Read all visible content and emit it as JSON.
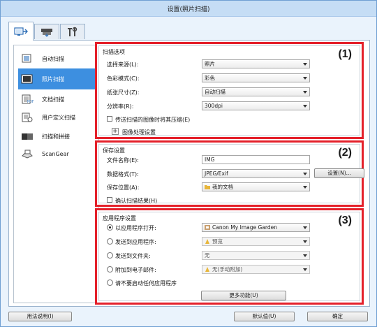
{
  "window": {
    "title": "设置(照片扫描)"
  },
  "tabs": [
    {
      "icon": "scan-from-computer-icon"
    },
    {
      "icon": "scanner-panel-icon"
    },
    {
      "icon": "general-settings-tools-icon"
    }
  ],
  "sidebar": {
    "items": [
      {
        "label": "自动扫描",
        "icon": "auto-scan-icon"
      },
      {
        "label": "照片扫描",
        "icon": "photo-scan-icon",
        "selected": true
      },
      {
        "label": "文档扫描",
        "icon": "document-scan-icon"
      },
      {
        "label": "用户定义扫描",
        "icon": "custom-scan-icon"
      },
      {
        "label": "扫描和拼接",
        "icon": "scan-stitch-icon"
      },
      {
        "label": "ScanGear",
        "icon": "scangear-icon"
      }
    ]
  },
  "scan_options": {
    "title": "扫描选项",
    "number": "(1)",
    "source": {
      "label": "选择来源(L):",
      "value": "照片"
    },
    "color_mode": {
      "label": "色彩模式(C):",
      "value": "彩色"
    },
    "paper_size": {
      "label": "纸张尺寸(Z):",
      "value": "自动扫描"
    },
    "resolution": {
      "label": "分辨率(R):",
      "value": "300dpi"
    },
    "compress_checkbox": {
      "label": "传送扫描的图像时将其压缩(E)",
      "checked": false
    },
    "image_processing": {
      "label": "图像处理设置"
    }
  },
  "save_settings": {
    "title": "保存设置",
    "number": "(2)",
    "file_name": {
      "label": "文件名称(E):",
      "value": "IMG"
    },
    "data_format": {
      "label": "数据格式(T):",
      "value": "JPEG/Exif"
    },
    "settings_button": "设置(N)...",
    "save_in": {
      "label": "保存位置(A):",
      "value": "我的文档"
    },
    "confirm_checkbox": {
      "label": "确认扫描结果(H)",
      "checked": false
    }
  },
  "app_settings": {
    "title": "应用程序设置",
    "number": "(3)",
    "open_with": {
      "label": "以应用程序打开:",
      "value": "Canon My Image Garden",
      "selected": true
    },
    "send_to_app": {
      "label": "发送到应用程序:",
      "value": "预览",
      "selected": false
    },
    "send_to_folder": {
      "label": "发送到文件夹:",
      "value": "无",
      "selected": false
    },
    "attach_email": {
      "label": "附加到电子邮件:",
      "value": "无(手动附加)",
      "selected": false
    },
    "do_not_start": {
      "label": "请不要启动任何应用程序",
      "selected": false
    },
    "more_functions_button": "更多功能(U)"
  },
  "footer": {
    "help_button": "用法说明(I)",
    "defaults_button": "默认值(U)",
    "ok_button": "确定"
  },
  "colors": {
    "highlight": "#e4202a",
    "selected_nav": "#3d8fe0",
    "titlebar": "#c5ddf5"
  }
}
